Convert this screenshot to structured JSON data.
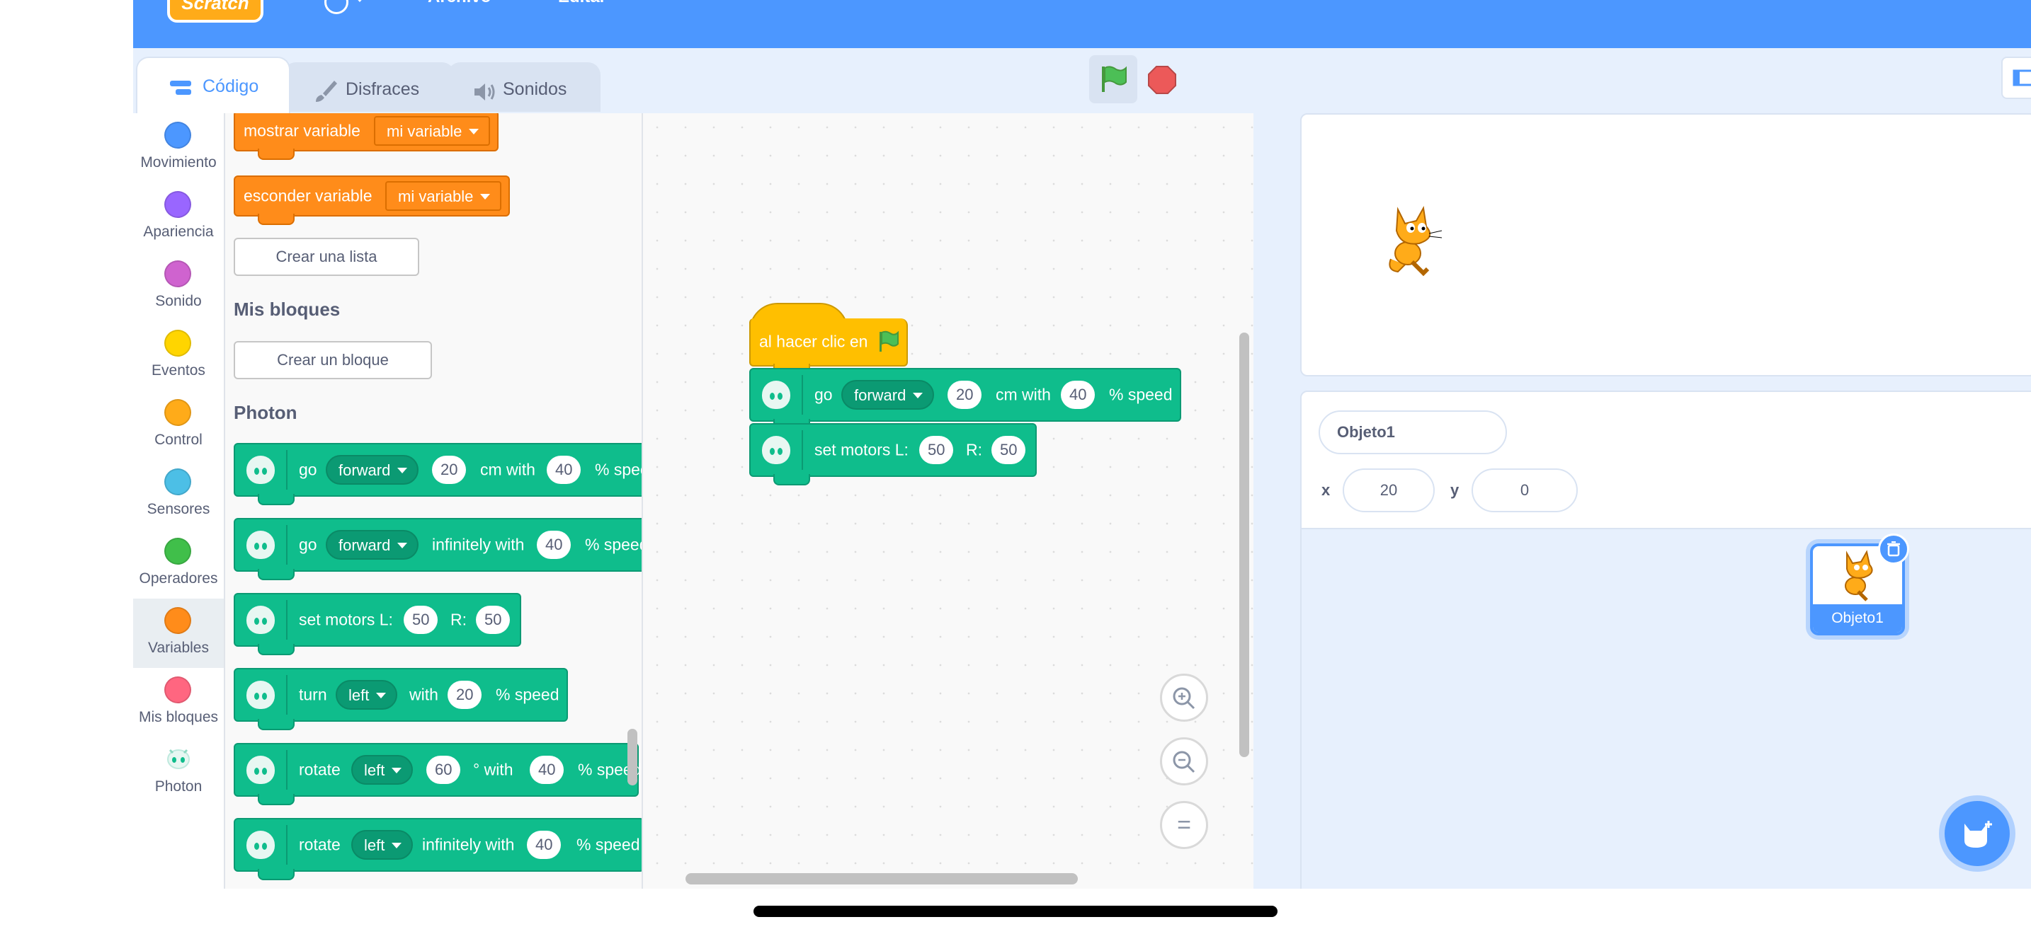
{
  "menubar": {
    "logo": "Scratch",
    "file_menu": "Archivo",
    "edit_menu": "Editar"
  },
  "tabs": [
    {
      "label": "Código",
      "icon": "code-icon"
    },
    {
      "label": "Disfraces",
      "icon": "brush-icon"
    },
    {
      "label": "Sonidos",
      "icon": "speaker-icon"
    }
  ],
  "categories": [
    {
      "label": "Movimiento",
      "color": "#4c97ff"
    },
    {
      "label": "Apariencia",
      "color": "#9966ff"
    },
    {
      "label": "Sonido",
      "color": "#cf63cf"
    },
    {
      "label": "Eventos",
      "color": "#ffd500"
    },
    {
      "label": "Control",
      "color": "#ffab19"
    },
    {
      "label": "Sensores",
      "color": "#4cbfe6"
    },
    {
      "label": "Operadores",
      "color": "#40bf4a"
    },
    {
      "label": "Variables",
      "color": "#ff8c1a"
    },
    {
      "label": "Mis bloques",
      "color": "#ff6680"
    },
    {
      "label": "Photon",
      "color": "#bfe9de"
    }
  ],
  "palette": {
    "show_var": {
      "text": "mostrar variable",
      "dropdown": "mi variable"
    },
    "hide_var": {
      "text": "esconder variable",
      "dropdown": "mi variable"
    },
    "make_list_button": "Crear una lista",
    "my_blocks_heading": "Mis bloques",
    "make_block_button": "Crear un bloque",
    "photon_heading": "Photon",
    "go_cm": {
      "go": "go",
      "dir": "forward",
      "dist": "20",
      "cm_with": "cm with",
      "speed": "40",
      "speed_label": "% speed"
    },
    "go_inf": {
      "go": "go",
      "dir": "forward",
      "inf_with": "infinitely with",
      "speed": "40",
      "speed_label": "% speed"
    },
    "motors": {
      "label": "set motors L:",
      "l": "50",
      "r_label": "R:",
      "r": "50"
    },
    "turn": {
      "turn": "turn",
      "dir": "left",
      "with": "with",
      "speed": "20",
      "speed_label": "% speed"
    },
    "rotate_deg": {
      "rotate": "rotate",
      "dir": "left",
      "deg": "60",
      "deg_with": "° with",
      "speed": "40",
      "speed_label": "% speed"
    },
    "rotate_inf": {
      "rotate": "rotate",
      "dir": "left",
      "inf_with": "infinitely with",
      "speed": "40",
      "speed_label": "% speed"
    }
  },
  "script": {
    "hat": {
      "text": "al hacer clic en"
    },
    "go_cm": {
      "go": "go",
      "dir": "forward",
      "dist": "20",
      "cm_with": "cm with",
      "speed": "40",
      "speed_label": "% speed"
    },
    "motors": {
      "label": "set motors L:",
      "l": "50",
      "r_label": "R:",
      "r": "50"
    }
  },
  "zoom": {
    "in": "+",
    "out": "−",
    "reset": "="
  },
  "sprite": {
    "name_value": "Objeto1",
    "x_label": "x",
    "x_value": "20",
    "y_label": "y",
    "y_value": "0",
    "card_name": "Objeto1"
  }
}
